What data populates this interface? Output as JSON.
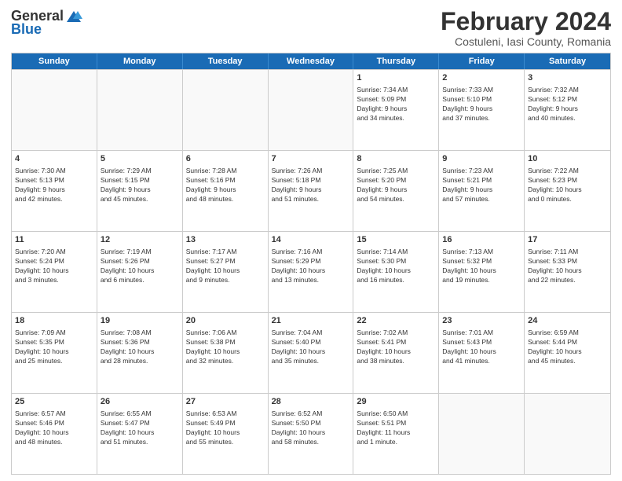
{
  "logo": {
    "general": "General",
    "blue": "Blue"
  },
  "title": "February 2024",
  "subtitle": "Costuleni, Iasi County, Romania",
  "header_days": [
    "Sunday",
    "Monday",
    "Tuesday",
    "Wednesday",
    "Thursday",
    "Friday",
    "Saturday"
  ],
  "weeks": [
    [
      {
        "day": "",
        "info": "",
        "empty": true
      },
      {
        "day": "",
        "info": "",
        "empty": true
      },
      {
        "day": "",
        "info": "",
        "empty": true
      },
      {
        "day": "",
        "info": "",
        "empty": true
      },
      {
        "day": "1",
        "info": "Sunrise: 7:34 AM\nSunset: 5:09 PM\nDaylight: 9 hours\nand 34 minutes."
      },
      {
        "day": "2",
        "info": "Sunrise: 7:33 AM\nSunset: 5:10 PM\nDaylight: 9 hours\nand 37 minutes."
      },
      {
        "day": "3",
        "info": "Sunrise: 7:32 AM\nSunset: 5:12 PM\nDaylight: 9 hours\nand 40 minutes."
      }
    ],
    [
      {
        "day": "4",
        "info": "Sunrise: 7:30 AM\nSunset: 5:13 PM\nDaylight: 9 hours\nand 42 minutes."
      },
      {
        "day": "5",
        "info": "Sunrise: 7:29 AM\nSunset: 5:15 PM\nDaylight: 9 hours\nand 45 minutes."
      },
      {
        "day": "6",
        "info": "Sunrise: 7:28 AM\nSunset: 5:16 PM\nDaylight: 9 hours\nand 48 minutes."
      },
      {
        "day": "7",
        "info": "Sunrise: 7:26 AM\nSunset: 5:18 PM\nDaylight: 9 hours\nand 51 minutes."
      },
      {
        "day": "8",
        "info": "Sunrise: 7:25 AM\nSunset: 5:20 PM\nDaylight: 9 hours\nand 54 minutes."
      },
      {
        "day": "9",
        "info": "Sunrise: 7:23 AM\nSunset: 5:21 PM\nDaylight: 9 hours\nand 57 minutes."
      },
      {
        "day": "10",
        "info": "Sunrise: 7:22 AM\nSunset: 5:23 PM\nDaylight: 10 hours\nand 0 minutes."
      }
    ],
    [
      {
        "day": "11",
        "info": "Sunrise: 7:20 AM\nSunset: 5:24 PM\nDaylight: 10 hours\nand 3 minutes."
      },
      {
        "day": "12",
        "info": "Sunrise: 7:19 AM\nSunset: 5:26 PM\nDaylight: 10 hours\nand 6 minutes."
      },
      {
        "day": "13",
        "info": "Sunrise: 7:17 AM\nSunset: 5:27 PM\nDaylight: 10 hours\nand 9 minutes."
      },
      {
        "day": "14",
        "info": "Sunrise: 7:16 AM\nSunset: 5:29 PM\nDaylight: 10 hours\nand 13 minutes."
      },
      {
        "day": "15",
        "info": "Sunrise: 7:14 AM\nSunset: 5:30 PM\nDaylight: 10 hours\nand 16 minutes."
      },
      {
        "day": "16",
        "info": "Sunrise: 7:13 AM\nSunset: 5:32 PM\nDaylight: 10 hours\nand 19 minutes."
      },
      {
        "day": "17",
        "info": "Sunrise: 7:11 AM\nSunset: 5:33 PM\nDaylight: 10 hours\nand 22 minutes."
      }
    ],
    [
      {
        "day": "18",
        "info": "Sunrise: 7:09 AM\nSunset: 5:35 PM\nDaylight: 10 hours\nand 25 minutes."
      },
      {
        "day": "19",
        "info": "Sunrise: 7:08 AM\nSunset: 5:36 PM\nDaylight: 10 hours\nand 28 minutes."
      },
      {
        "day": "20",
        "info": "Sunrise: 7:06 AM\nSunset: 5:38 PM\nDaylight: 10 hours\nand 32 minutes."
      },
      {
        "day": "21",
        "info": "Sunrise: 7:04 AM\nSunset: 5:40 PM\nDaylight: 10 hours\nand 35 minutes."
      },
      {
        "day": "22",
        "info": "Sunrise: 7:02 AM\nSunset: 5:41 PM\nDaylight: 10 hours\nand 38 minutes."
      },
      {
        "day": "23",
        "info": "Sunrise: 7:01 AM\nSunset: 5:43 PM\nDaylight: 10 hours\nand 41 minutes."
      },
      {
        "day": "24",
        "info": "Sunrise: 6:59 AM\nSunset: 5:44 PM\nDaylight: 10 hours\nand 45 minutes."
      }
    ],
    [
      {
        "day": "25",
        "info": "Sunrise: 6:57 AM\nSunset: 5:46 PM\nDaylight: 10 hours\nand 48 minutes."
      },
      {
        "day": "26",
        "info": "Sunrise: 6:55 AM\nSunset: 5:47 PM\nDaylight: 10 hours\nand 51 minutes."
      },
      {
        "day": "27",
        "info": "Sunrise: 6:53 AM\nSunset: 5:49 PM\nDaylight: 10 hours\nand 55 minutes."
      },
      {
        "day": "28",
        "info": "Sunrise: 6:52 AM\nSunset: 5:50 PM\nDaylight: 10 hours\nand 58 minutes."
      },
      {
        "day": "29",
        "info": "Sunrise: 6:50 AM\nSunset: 5:51 PM\nDaylight: 11 hours\nand 1 minute."
      },
      {
        "day": "",
        "info": "",
        "empty": true
      },
      {
        "day": "",
        "info": "",
        "empty": true
      }
    ]
  ]
}
